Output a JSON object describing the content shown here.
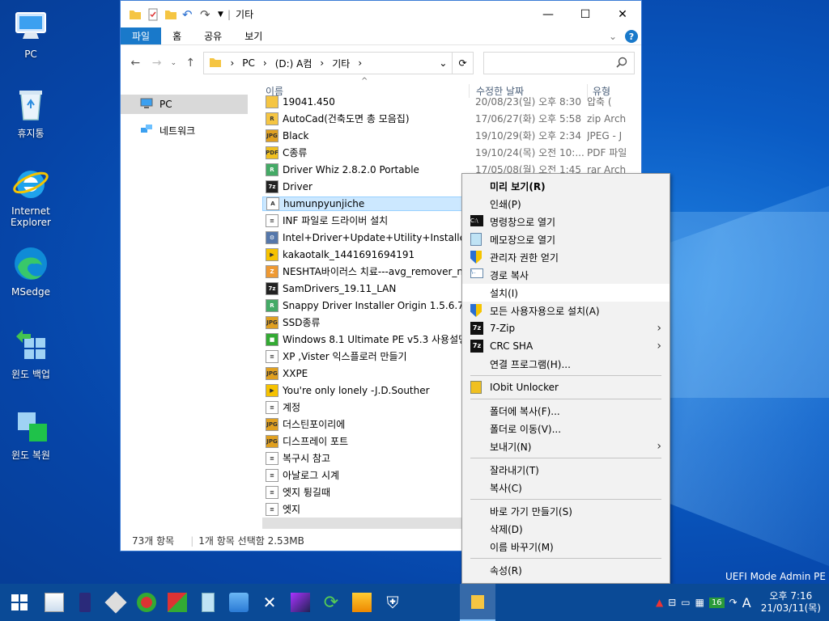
{
  "desktop": {
    "icons": [
      {
        "label": "PC"
      },
      {
        "label": "휴지통"
      },
      {
        "label": "Internet Explorer"
      },
      {
        "label": "MSedge"
      },
      {
        "label": "윈도 백업"
      },
      {
        "label": "윈도 복원"
      }
    ],
    "watermark": "UEFI Mode Admin PE"
  },
  "window": {
    "title": "기타",
    "ribbon_tabs": [
      "파일",
      "홈",
      "공유",
      "보기"
    ],
    "address": {
      "segments": [
        "PC",
        "(D:) A컴",
        "기타"
      ]
    },
    "nav_pane": [
      {
        "label": "PC",
        "selected": true
      },
      {
        "label": "네트워크",
        "selected": false
      }
    ],
    "columns": {
      "name": "이름",
      "date": "수정한 날짜",
      "type": "유형"
    },
    "files": [
      {
        "name": "19041.450",
        "date": "20/08/23(일) 오후 8:30",
        "type": "압축 (",
        "icon": "folder-zip"
      },
      {
        "name": "AutoCad(건축도면 총 모음집)",
        "date": "17/06/27(화) 오후 5:58",
        "type": "zip Arch",
        "icon": "autocad"
      },
      {
        "name": "Black",
        "date": "19/10/29(화) 오후 2:34",
        "type": "JPEG - J",
        "icon": "jpeg"
      },
      {
        "name": "C종류",
        "date": "19/10/24(목) 오전 10:...",
        "type": "PDF 파일",
        "icon": "pdf"
      },
      {
        "name": "Driver Whiz 2.8.2.0 Portable",
        "date": "17/05/08(월) 오전 1:45",
        "type": "rar Arch",
        "icon": "rar"
      },
      {
        "name": "Driver",
        "date": "",
        "type": "",
        "icon": "7z"
      },
      {
        "name": "humunpyunjiche",
        "date": "",
        "type": "",
        "icon": "font",
        "selected": true
      },
      {
        "name": "INF 파일로 드라이버 설치",
        "date": "",
        "type": "",
        "icon": "text"
      },
      {
        "name": "Intel+Driver+Update+Utility+Installer",
        "date": "",
        "type": "",
        "icon": "setup"
      },
      {
        "name": "kakaotalk_1441691694191",
        "date": "",
        "type": "",
        "icon": "media"
      },
      {
        "name": "NESHTA바이러스 치료---avg_remover_n...",
        "date": "",
        "type": "",
        "icon": "zip"
      },
      {
        "name": "SamDrivers_19.11_LAN",
        "date": "",
        "type": "",
        "icon": "7z"
      },
      {
        "name": "Snappy Driver Installer Origin 1.5.6.705 ...",
        "date": "",
        "type": "",
        "icon": "rar"
      },
      {
        "name": "SSD종류",
        "date": "",
        "type": "",
        "icon": "jpeg"
      },
      {
        "name": "Windows 8.1 Ultimate PE v5.3 사용설명...",
        "date": "",
        "type": "",
        "icon": "book"
      },
      {
        "name": "XP ,Vister 익스플로러 만들기",
        "date": "",
        "type": "",
        "icon": "text"
      },
      {
        "name": "XXPE",
        "date": "",
        "type": "",
        "icon": "jpeg"
      },
      {
        "name": "You're only lonely -J.D.Souther",
        "date": "",
        "type": "",
        "icon": "media"
      },
      {
        "name": "계정",
        "date": "",
        "type": "",
        "icon": "text"
      },
      {
        "name": "더스틴포이리에",
        "date": "",
        "type": "",
        "icon": "jpeg"
      },
      {
        "name": "디스프레이 포트",
        "date": "",
        "type": "",
        "icon": "jpeg"
      },
      {
        "name": "복구시 참고",
        "date": "",
        "type": "",
        "icon": "text"
      },
      {
        "name": "아날로그 시계",
        "date": "",
        "type": "",
        "icon": "text"
      },
      {
        "name": "엣지 튕길때",
        "date": "",
        "type": "",
        "icon": "text"
      },
      {
        "name": "엣지",
        "date": "",
        "type": "",
        "icon": "text"
      }
    ],
    "status": {
      "count": "73개 항목",
      "selection": "1개 항목 선택함 2.53MB"
    }
  },
  "context_menu": [
    {
      "label": "미리 보기(R)",
      "bold": true
    },
    {
      "label": "인쇄(P)"
    },
    {
      "label": "명령창으로 열기",
      "icon": "cmd-icon"
    },
    {
      "label": "메모장으로 열기",
      "icon": "notepad-icon"
    },
    {
      "label": "관리자 권한 얻기",
      "icon": "shield-icon"
    },
    {
      "label": "경로 복사",
      "icon": "path-icon"
    },
    {
      "label": "설치(I)",
      "highlight": true
    },
    {
      "label": "모든 사용자용으로 설치(A)",
      "icon": "shield-icon"
    },
    {
      "label": "7-Zip",
      "icon": "7z-icon",
      "submenu": true
    },
    {
      "label": "CRC SHA",
      "icon": "7z-icon",
      "submenu": true
    },
    {
      "label": "연결 프로그램(H)..."
    },
    {
      "sep": true
    },
    {
      "label": "IObit Unlocker",
      "icon": "unlock-icon"
    },
    {
      "sep": true
    },
    {
      "label": "폴더에 복사(F)..."
    },
    {
      "label": "폴더로 이동(V)..."
    },
    {
      "label": "보내기(N)",
      "submenu": true
    },
    {
      "sep": true
    },
    {
      "label": "잘라내기(T)"
    },
    {
      "label": "복사(C)"
    },
    {
      "sep": true
    },
    {
      "label": "바로 가기 만들기(S)"
    },
    {
      "label": "삭제(D)"
    },
    {
      "label": "이름 바꾸기(M)"
    },
    {
      "sep": true
    },
    {
      "label": "속성(R)"
    }
  ],
  "taskbar": {
    "tray_badge": "16",
    "ime": "A",
    "time": "오후 7:16",
    "date": "21/03/11(목)"
  }
}
